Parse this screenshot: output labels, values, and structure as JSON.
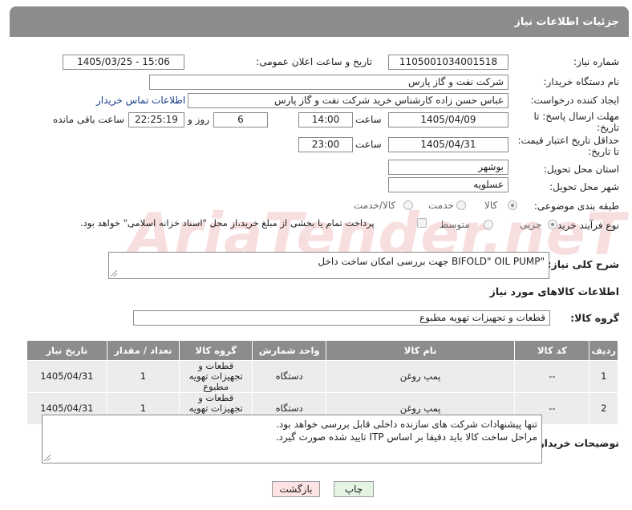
{
  "header": {
    "title": "جزئیات اطلاعات نیاز"
  },
  "fields": {
    "need_number_label": "شماره نیاز:",
    "need_number": "1105001034001518",
    "announce_label": "تاریخ و ساعت اعلان عمومی:",
    "announce_value": "1405/03/25 - 15:06",
    "buyer_label": "نام دستگاه خریدار:",
    "buyer_value": "شرکت نفت و گاز پارس",
    "creator_label": "ایجاد کننده درخواست:",
    "creator_value": "عباس حسن زاده کارشناس خرید شرکت نفت و گاز پارس",
    "contact_link": "اطلاعات تماس خریدار",
    "deadline_label_1": "مهلت ارسال پاسخ: تا",
    "deadline_label_2": "تاریخ:",
    "deadline_date": "1405/04/09",
    "time_label": "ساعت",
    "deadline_time": "14:00",
    "days_value": "6",
    "days_label": "روز و",
    "remaining_time": "22:25:19",
    "remaining_label": "ساعت باقی مانده",
    "validity_label_1": "حداقل تاریخ اعتبار قیمت:",
    "validity_label_2": "تا تاریخ:",
    "validity_date": "1405/04/31",
    "validity_time_label": "ساعت",
    "validity_time": "23:00",
    "province_label": "استان محل تحویل:",
    "province_value": "بوشهر",
    "city_label": "شهر محل تحویل:",
    "city_value": "عسلویه",
    "category_label": "طبقه بندی موضوعی:",
    "category_options": [
      "کالا",
      "خدمت",
      "کالا/خدمت"
    ],
    "purchase_label": "نوع فرآیند خرید :",
    "purchase_options": [
      "جزیی",
      "متوسط"
    ],
    "payment_note": "پرداخت تمام یا بخشی از مبلغ خرید،از محل \"اسناد خزانه اسلامی\" خواهد بود."
  },
  "description": {
    "label": "شرح کلی نیاز:",
    "text": "\"BIFOLD\" OIL PUMP  جهت بررسی امکان ساخت داخل"
  },
  "goods": {
    "section_title": "اطلاعات کالاهای مورد نیاز",
    "group_label": "گروه کالا:",
    "group_value": "قطعات و تجهیزات تهویه مطبوع",
    "columns": [
      "ردیف",
      "کد کالا",
      "نام کالا",
      "واحد شمارش",
      "گروه کالا",
      "تعداد / مقدار",
      "تاریخ نیاز"
    ],
    "rows": [
      {
        "row": "1",
        "code": "--",
        "name": "پمپ روغن",
        "unit": "دستگاه",
        "group": "قطعات و تجهیزات تهویه مطبوع",
        "qty": "1",
        "date": "1405/04/31"
      },
      {
        "row": "2",
        "code": "--",
        "name": "پمپ روغن",
        "unit": "دستگاه",
        "group": "قطعات و تجهیزات تهویه مطبوع",
        "qty": "1",
        "date": "1405/04/31"
      }
    ]
  },
  "buyer_notes": {
    "label": "توضیحات خریدار:",
    "line1": "تنها پیشنهادات شرکت های سازنده داخلی قابل بررسی خواهد بود.",
    "line2": "مراحل ساخت کالا باید دقیقا بر اساس ITP تایید شده صورت گیرد."
  },
  "buttons": {
    "print": "چاپ",
    "back": "بازگشت"
  },
  "watermark": {
    "text": "AriaTender.neT"
  },
  "colors": {
    "header_bg": "#8c8c8c",
    "back_button_bg": "#fde3e3",
    "print_button_bg": "#e3f4e3"
  }
}
